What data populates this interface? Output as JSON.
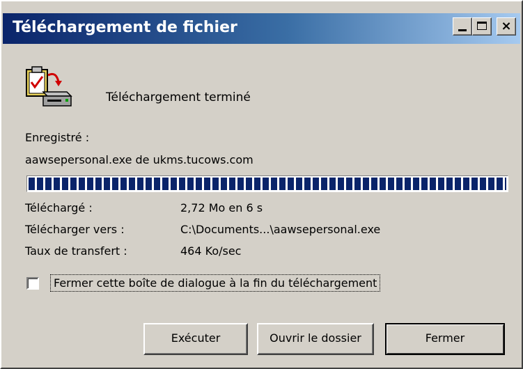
{
  "window": {
    "title": "Téléchargement de fichier",
    "controls": {
      "minimize": "_",
      "maximize": "□",
      "close": "×"
    }
  },
  "status": {
    "icon": "download-complete-icon",
    "text": "Téléchargement terminé"
  },
  "saved": {
    "label": "Enregistré :",
    "file": "aawsepersonal.exe de ukms.tucows.com"
  },
  "progress": {
    "percent": 100
  },
  "details": [
    {
      "label": "Téléchargé :",
      "value": "2,72 Mo en 6 s"
    },
    {
      "label": "Télécharger vers :",
      "value": "C:\\Documents...\\aawsepersonal.exe"
    },
    {
      "label": "Taux de transfert :",
      "value": "464 Ko/sec"
    }
  ],
  "options": {
    "close_when_done_label": "Fermer cette boîte de dialogue à la fin du téléchargement",
    "close_when_done_checked": false
  },
  "buttons": {
    "run": "Exécuter",
    "open_folder": "Ouvrir le dossier",
    "close": "Fermer"
  },
  "colors": {
    "titlebar_start": "#0a246a",
    "titlebar_end": "#a6caf0",
    "progress_fill": "#0a246a",
    "dialog_face": "#d4d0c8"
  }
}
